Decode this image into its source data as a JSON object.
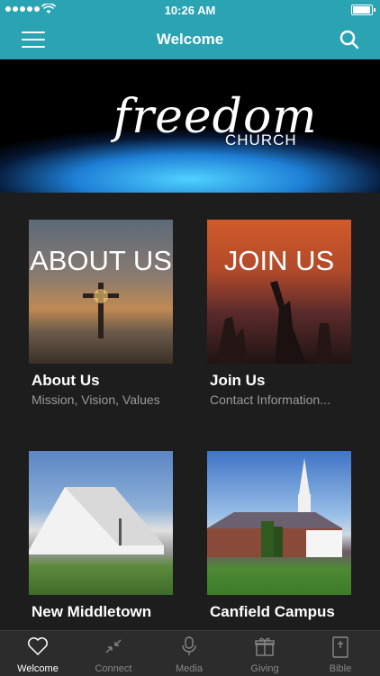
{
  "status_bar": {
    "time": "10:26 AM"
  },
  "nav": {
    "title": "Welcome"
  },
  "banner": {
    "logo_main": "freedom",
    "logo_sub": "CHURCH"
  },
  "cards": [
    {
      "overlay": "ABOUT US",
      "title": "About Us",
      "subtitle": "Mission, Vision, Values"
    },
    {
      "overlay": "JOIN US",
      "title": "Join Us",
      "subtitle": "Contact Information..."
    },
    {
      "overlay": "",
      "title": "New Middletown",
      "subtitle": ""
    },
    {
      "overlay": "",
      "title": "Canfield Campus",
      "subtitle": ""
    }
  ],
  "tabs": [
    {
      "label": "Welcome",
      "icon": "heart-icon"
    },
    {
      "label": "Connect",
      "icon": "collapse-arrows-icon"
    },
    {
      "label": "Media",
      "icon": "microphone-icon"
    },
    {
      "label": "Giving",
      "icon": "gift-icon"
    },
    {
      "label": "Bible",
      "icon": "bible-icon"
    }
  ],
  "colors": {
    "brand": "#2aa3b2",
    "background": "#1e1e1e",
    "tab_active": "#ffffff",
    "tab_inactive": "#888888"
  }
}
